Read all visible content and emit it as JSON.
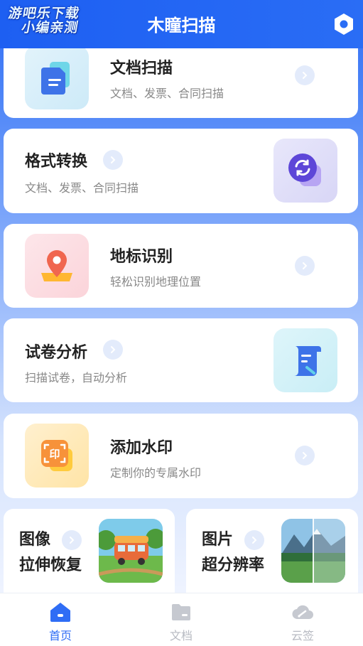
{
  "watermark": {
    "line1": "游吧乐下载",
    "line2": "小编亲测"
  },
  "header": {
    "title": "木瞳扫描",
    "settings_icon": "settings-hexagon-icon"
  },
  "cards": [
    {
      "title": "文档扫描",
      "subtitle": "文档、发票、合同扫描",
      "icon": "document-icon"
    },
    {
      "title": "格式转换",
      "subtitle": "文档、发票、合同扫描",
      "icon": "convert-icon"
    },
    {
      "title": "地标识别",
      "subtitle": "轻松识别地理位置",
      "icon": "location-pin-icon"
    },
    {
      "title": "试卷分析",
      "subtitle": "扫描试卷，自动分析",
      "icon": "exam-scroll-icon"
    },
    {
      "title": "添加水印",
      "subtitle": "定制你的专属水印",
      "icon": "stamp-icon"
    }
  ],
  "tiles": [
    {
      "line1": "图像",
      "line2": "拉伸恢复",
      "thumb": "bus-illustration"
    },
    {
      "line1": "图片",
      "line2": "超分辨率",
      "thumb": "mountain-landscape"
    }
  ],
  "tabbar": [
    {
      "label": "首页",
      "icon": "home-icon",
      "active": true
    },
    {
      "label": "文档",
      "icon": "folder-icon",
      "active": false
    },
    {
      "label": "云签",
      "icon": "cloud-sign-icon",
      "active": false
    }
  ],
  "colors": {
    "primary": "#2f6df5",
    "inactive": "#b7bac2",
    "chevron_bg": "#e3ebfb"
  }
}
